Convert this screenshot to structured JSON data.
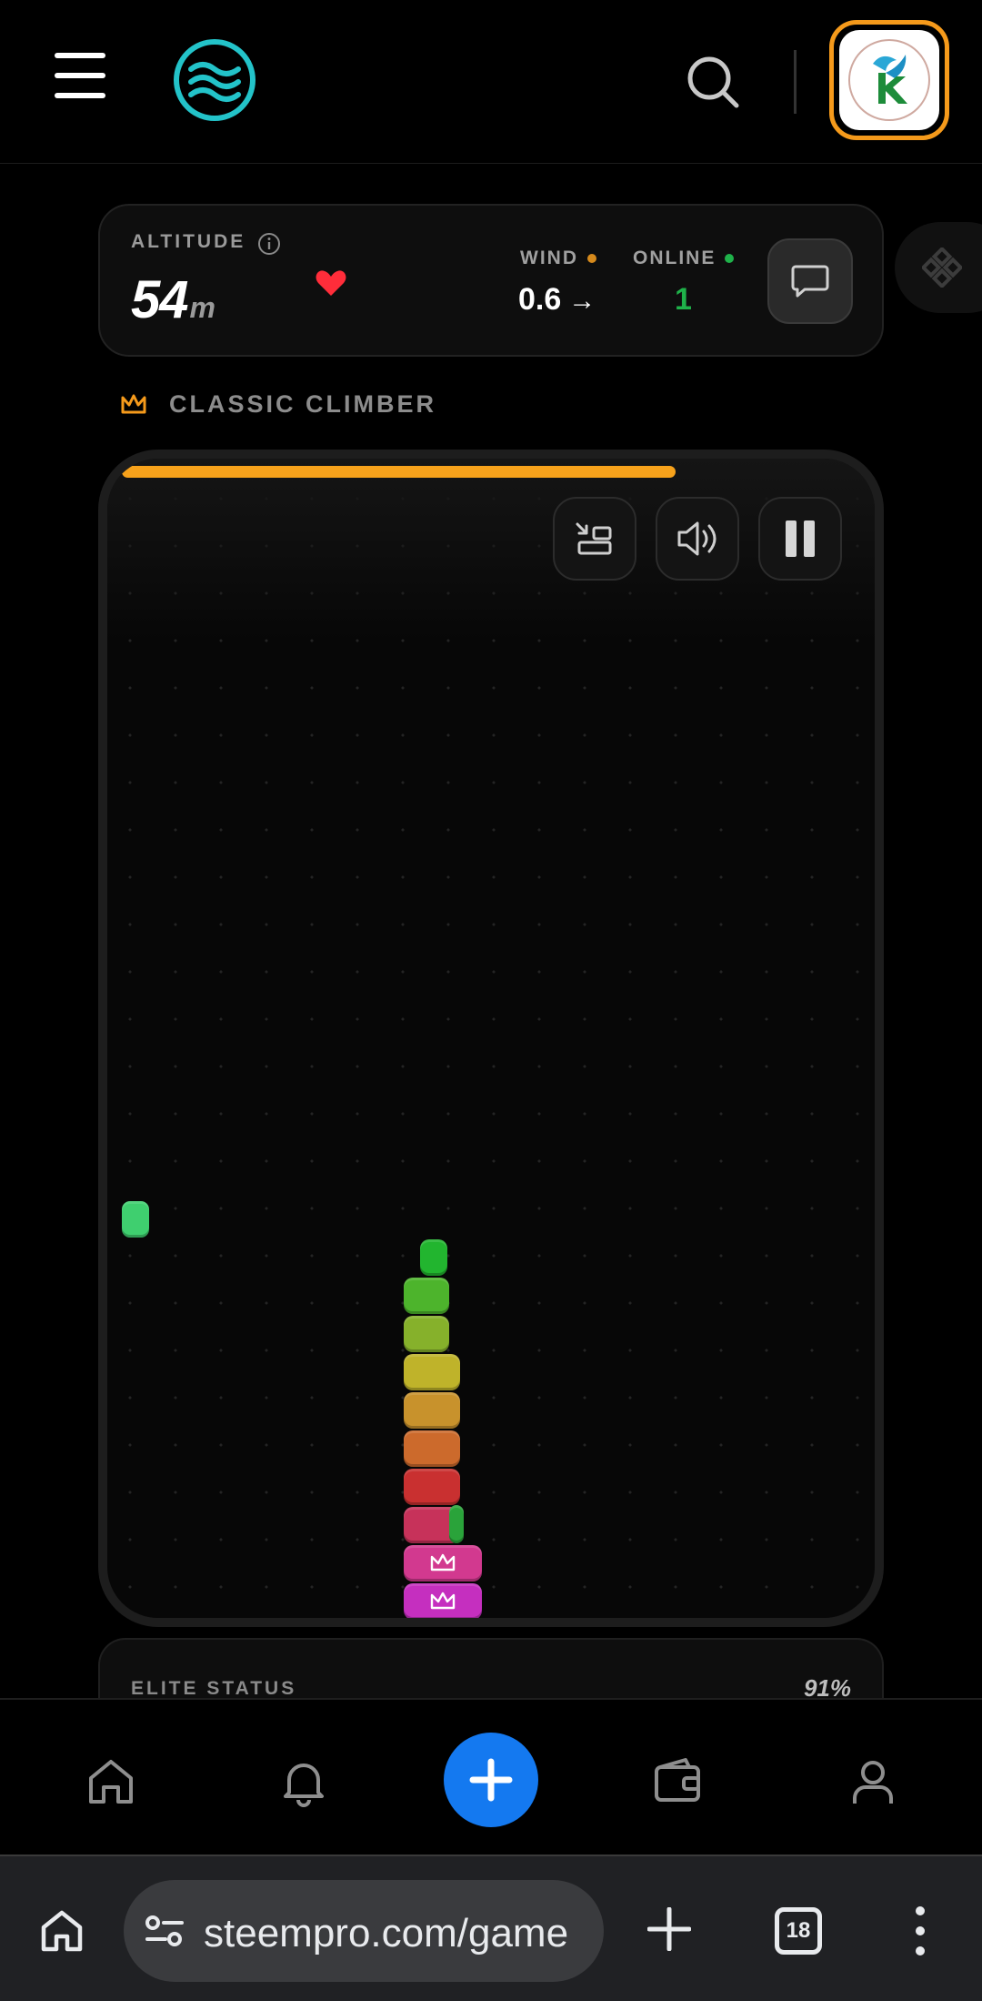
{
  "header": {
    "menu_icon": "hamburger-icon",
    "logo_icon": "waves-logo-icon",
    "search_icon": "search-icon",
    "avatar_icon": "hummingbird-logo-avatar"
  },
  "stats": {
    "altitude_label": "ALTITUDE",
    "altitude_value": "54",
    "altitude_unit": "m",
    "wind_label": "WIND",
    "wind_value": "0.6",
    "wind_arrow": "→",
    "online_label": "ONLINE",
    "online_value": "1",
    "colors": {
      "wind_dot": "#d68a1c",
      "online_dot": "#1fb24a",
      "heart": "#ff2d3a"
    }
  },
  "game": {
    "mode_label": "CLASSIC CLIMBER",
    "progress": 0.75,
    "progress_color": "#f7a21b",
    "controls": [
      "swap-icon",
      "sound-icon",
      "pause-icon"
    ]
  },
  "elite": {
    "label": "ELITE STATUS",
    "value": "91%"
  },
  "bottom_nav": [
    "home-icon",
    "bell-icon",
    "add-icon",
    "wallet-icon",
    "profile-icon"
  ],
  "browser": {
    "url": "steempro.com/game",
    "tab_count": "18"
  }
}
